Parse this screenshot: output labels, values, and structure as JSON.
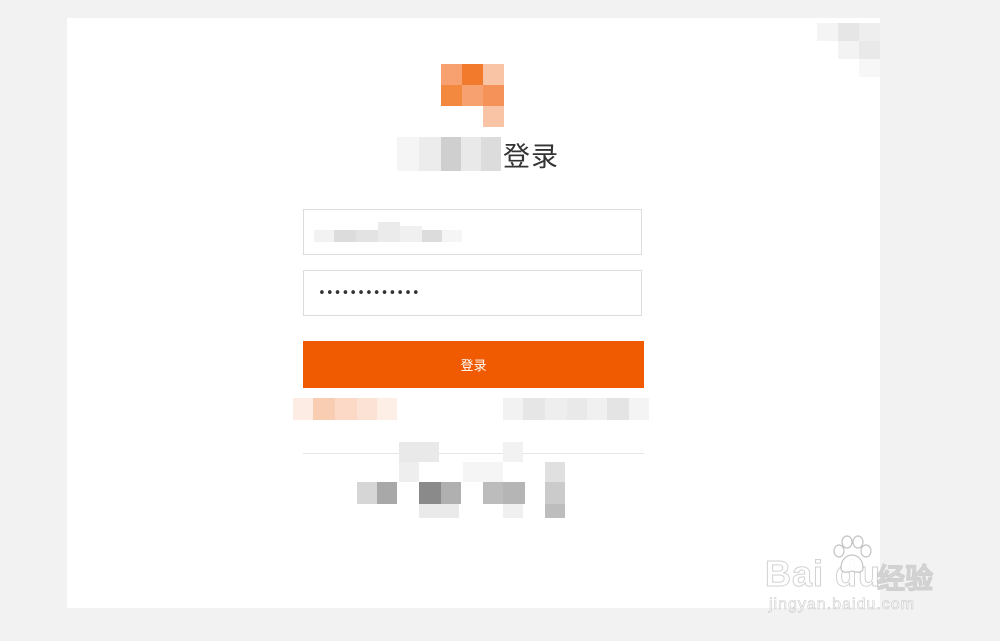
{
  "login": {
    "title": "登录",
    "password_value": "•••••••••••••",
    "submit_label": "登录"
  },
  "colors": {
    "accent": "#f05a00",
    "page_bg": "#f2f2f2",
    "card_bg": "#ffffff",
    "border": "#dcdcdc"
  },
  "watermark": {
    "brand": "Bai du",
    "cn": "经验",
    "url": "jingyan.baidu.com"
  }
}
